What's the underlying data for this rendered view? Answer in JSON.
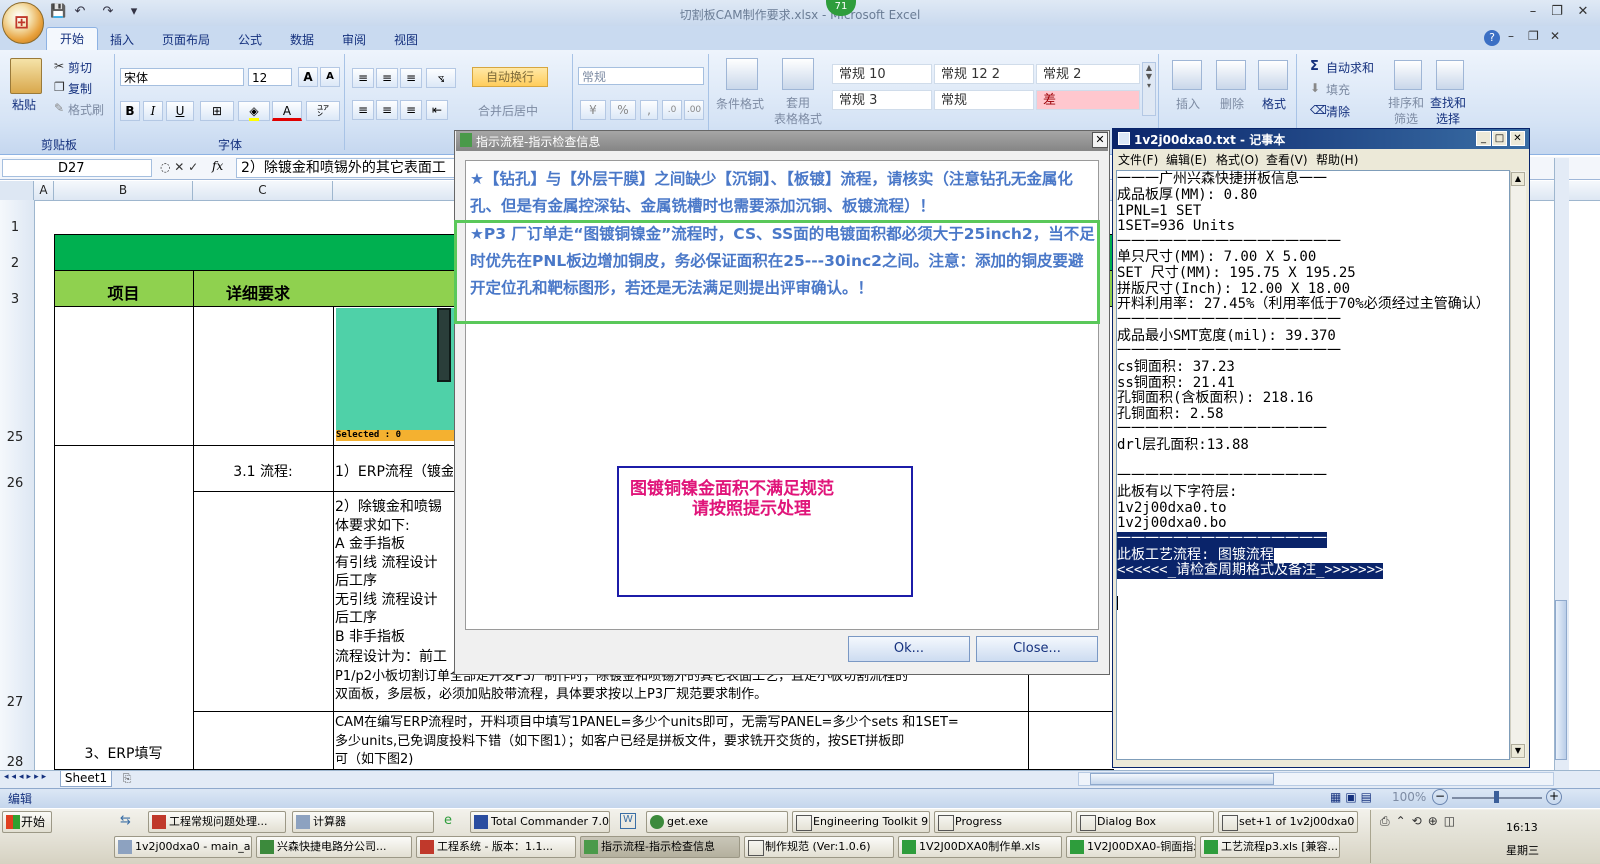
{
  "window": {
    "title": "切割板CAM制作要求.xlsx - Microsoft Excel",
    "badge": "71"
  },
  "ribbon": {
    "tabs": [
      "开始",
      "插入",
      "页面布局",
      "公式",
      "数据",
      "审阅",
      "视图"
    ],
    "clipboard": {
      "paste": "粘贴",
      "cut": "剪切",
      "copy": "复制",
      "format_painter": "格式刷",
      "label": "剪贴板"
    },
    "font": {
      "name": "宋体",
      "size": "12",
      "label": "字体",
      "bold": "B",
      "italic": "I",
      "underline": "U",
      "grow": "A",
      "shrink": "A",
      "font_color": "A"
    },
    "align": {
      "wrap": "自动换行",
      "merge": "合并后居中",
      "label": "对齐方式"
    },
    "number": {
      "format": "常规"
    },
    "styles": {
      "conditional": "条件格式",
      "table": "套用\n表格格式",
      "cells": [
        "常规 10",
        "常规 12 2",
        "常规 2",
        "常规 3",
        "常规",
        "差"
      ]
    },
    "cells": {
      "insert": "插入",
      "delete": "删除",
      "format": "格式"
    },
    "editing": {
      "autosum": "自动求和",
      "fill": "填充",
      "clear": "清除",
      "sort": "排序和\n筛选",
      "find": "查找和\n选择"
    }
  },
  "formula_bar": {
    "name_box": "D27",
    "fx": "fx",
    "content": "2）除镀金和喷锡外的其它表面工"
  },
  "grid": {
    "columns": [
      "A",
      "B",
      "C"
    ],
    "rows": [
      "1",
      "2",
      "3",
      "25",
      "26",
      "27",
      "28"
    ],
    "header_item": "项目",
    "header_detail": "详细要求",
    "row26_c": "3.1 流程:",
    "row26_d": "1）ERP流程（镀金",
    "row27_d_lines": [
      "2）除镀金和喷锡",
      "体要求如下:",
      "A 金手指板",
      "有引线 流程设计",
      "后工序",
      "无引线 流程设计",
      "后工序",
      "B   非手指板",
      "流程设计为：前工",
      "P1/p2小板切割订单全部走开发P3厂制作时，除镀金和喷锡外的其它表面工艺，且走小板切割流程的",
      "双面板，多层板，必须加贴胶带流程，具体要求按以上P3厂规范要求制作。"
    ],
    "row28_b": "3、ERP填写",
    "row28_d_lines": [
      "CAM在编写ERP流程时，开料项目中填写1PANEL=多少个units即可，无需写PANEL=多少个sets 和1SET=",
      "多少units,已免调度投料下错（如下图1）；如客户已经是拼板文件，要求铣开交货的，按SET拼板即",
      "可（如下图2)"
    ],
    "image_caption": "Selected : 0"
  },
  "dialog": {
    "title": "指示流程-指示检查信息",
    "line1": "★【钻孔】与【外层干膜】之间缺少【沉铜】、【板镀】流程，请核实（注意钻孔无金属化",
    "line2": "孔、但是有金属控深钻、金属铣槽时也需要添加沉铜、板镀流程）！",
    "line3": "★P3 厂订单走“图镀铜镍金”流程时，CS、SS面的电镀面积都必须大于25inch2，当不足",
    "line4": "时优先在PNL板边增加铜皮，务必保证面积在25---30inc2之间。注意：添加的铜皮要避",
    "line5": "开定位孔和靶标图形，若还是无法满足则提出评审确认。！",
    "warn1": "图镀铜镍金面积不满足规范",
    "warn2": "请按照提示处理",
    "ok": "Ok...",
    "close": "Close..."
  },
  "notepad": {
    "title": "1v2j00dxa0.txt - 记事本",
    "menu": [
      "文件(F)",
      "编辑(E)",
      "格式(O)",
      "查看(V)",
      "帮助(H)"
    ],
    "lines": [
      "一一一广州兴森快捷拼板信息一一",
      "成品板厚(MM): 0.80",
      "1PNL=1 SET",
      "1SET=936 Units",
      "一一一一一一一一一一一一一一一一",
      "单只尺寸(MM): 7.00 X 5.00",
      "SET 尺寸(MM): 195.75 X 195.25",
      "拼版尺寸(Inch): 12.00 X 18.00",
      "开料利用率: 27.45%（利用率低于70%必须经过主管确认）",
      "一一一一一一一一一一一一一一一一",
      "成品最小SMT宽度(mil): 39.370",
      "一一一一一一一一一一一一一一一一",
      "cs铜面积: 37.23",
      "ss铜面积: 21.41",
      "孔铜面积(含板面积): 218.16",
      "孔铜面积: 2.58",
      "一一一一一一一一一一一一一一一",
      "drl层孔面积:13.88",
      "",
      "一一一一一一一一一一一一一一一",
      "此板有以下字符层:",
      "1v2j00dxa0.to",
      "1v2j00dxa0.bo",
      "一一一一一一一一一一一一一一一",
      "此板工艺流程: 图镀流程",
      "<<<<<<_请检查周期格式及备注_>>>>>>>"
    ]
  },
  "sheet": {
    "tab": "Sheet1"
  },
  "status": {
    "mode": "编辑",
    "zoom": "100%"
  },
  "taskbar": {
    "start": "开始",
    "row1": [
      "工程常规问题处理...",
      "计算器",
      "Total Commander 7.0...",
      "get.exe",
      "Engineering Toolkit 9....",
      "Progress",
      "Dialog Box",
      "set+1 of 1v2j00dxa0"
    ],
    "row2": [
      "1v2j00dxa0 - main_a...",
      "兴森快捷电路分公司...",
      "工程系统 - 版本：1.1...",
      "指示流程-指示检查信息",
      "制作规范 (Ver:1.0.6)",
      "1V2J00DXA0制作单.xls",
      "1V2J00DXA0-铜面指示...",
      "工艺流程p3.xls [兼容..."
    ],
    "time": "16:13",
    "day": "星期三"
  },
  "colors": {
    "header_green": "#8fd14f",
    "title_green": "#00b050",
    "dialog_text": "#4a78c8",
    "warn_text": "#e0157a",
    "highlight_box": "#5ac85a",
    "warn_box": "#1c1ca8",
    "notepad_select": "#0a246a"
  }
}
